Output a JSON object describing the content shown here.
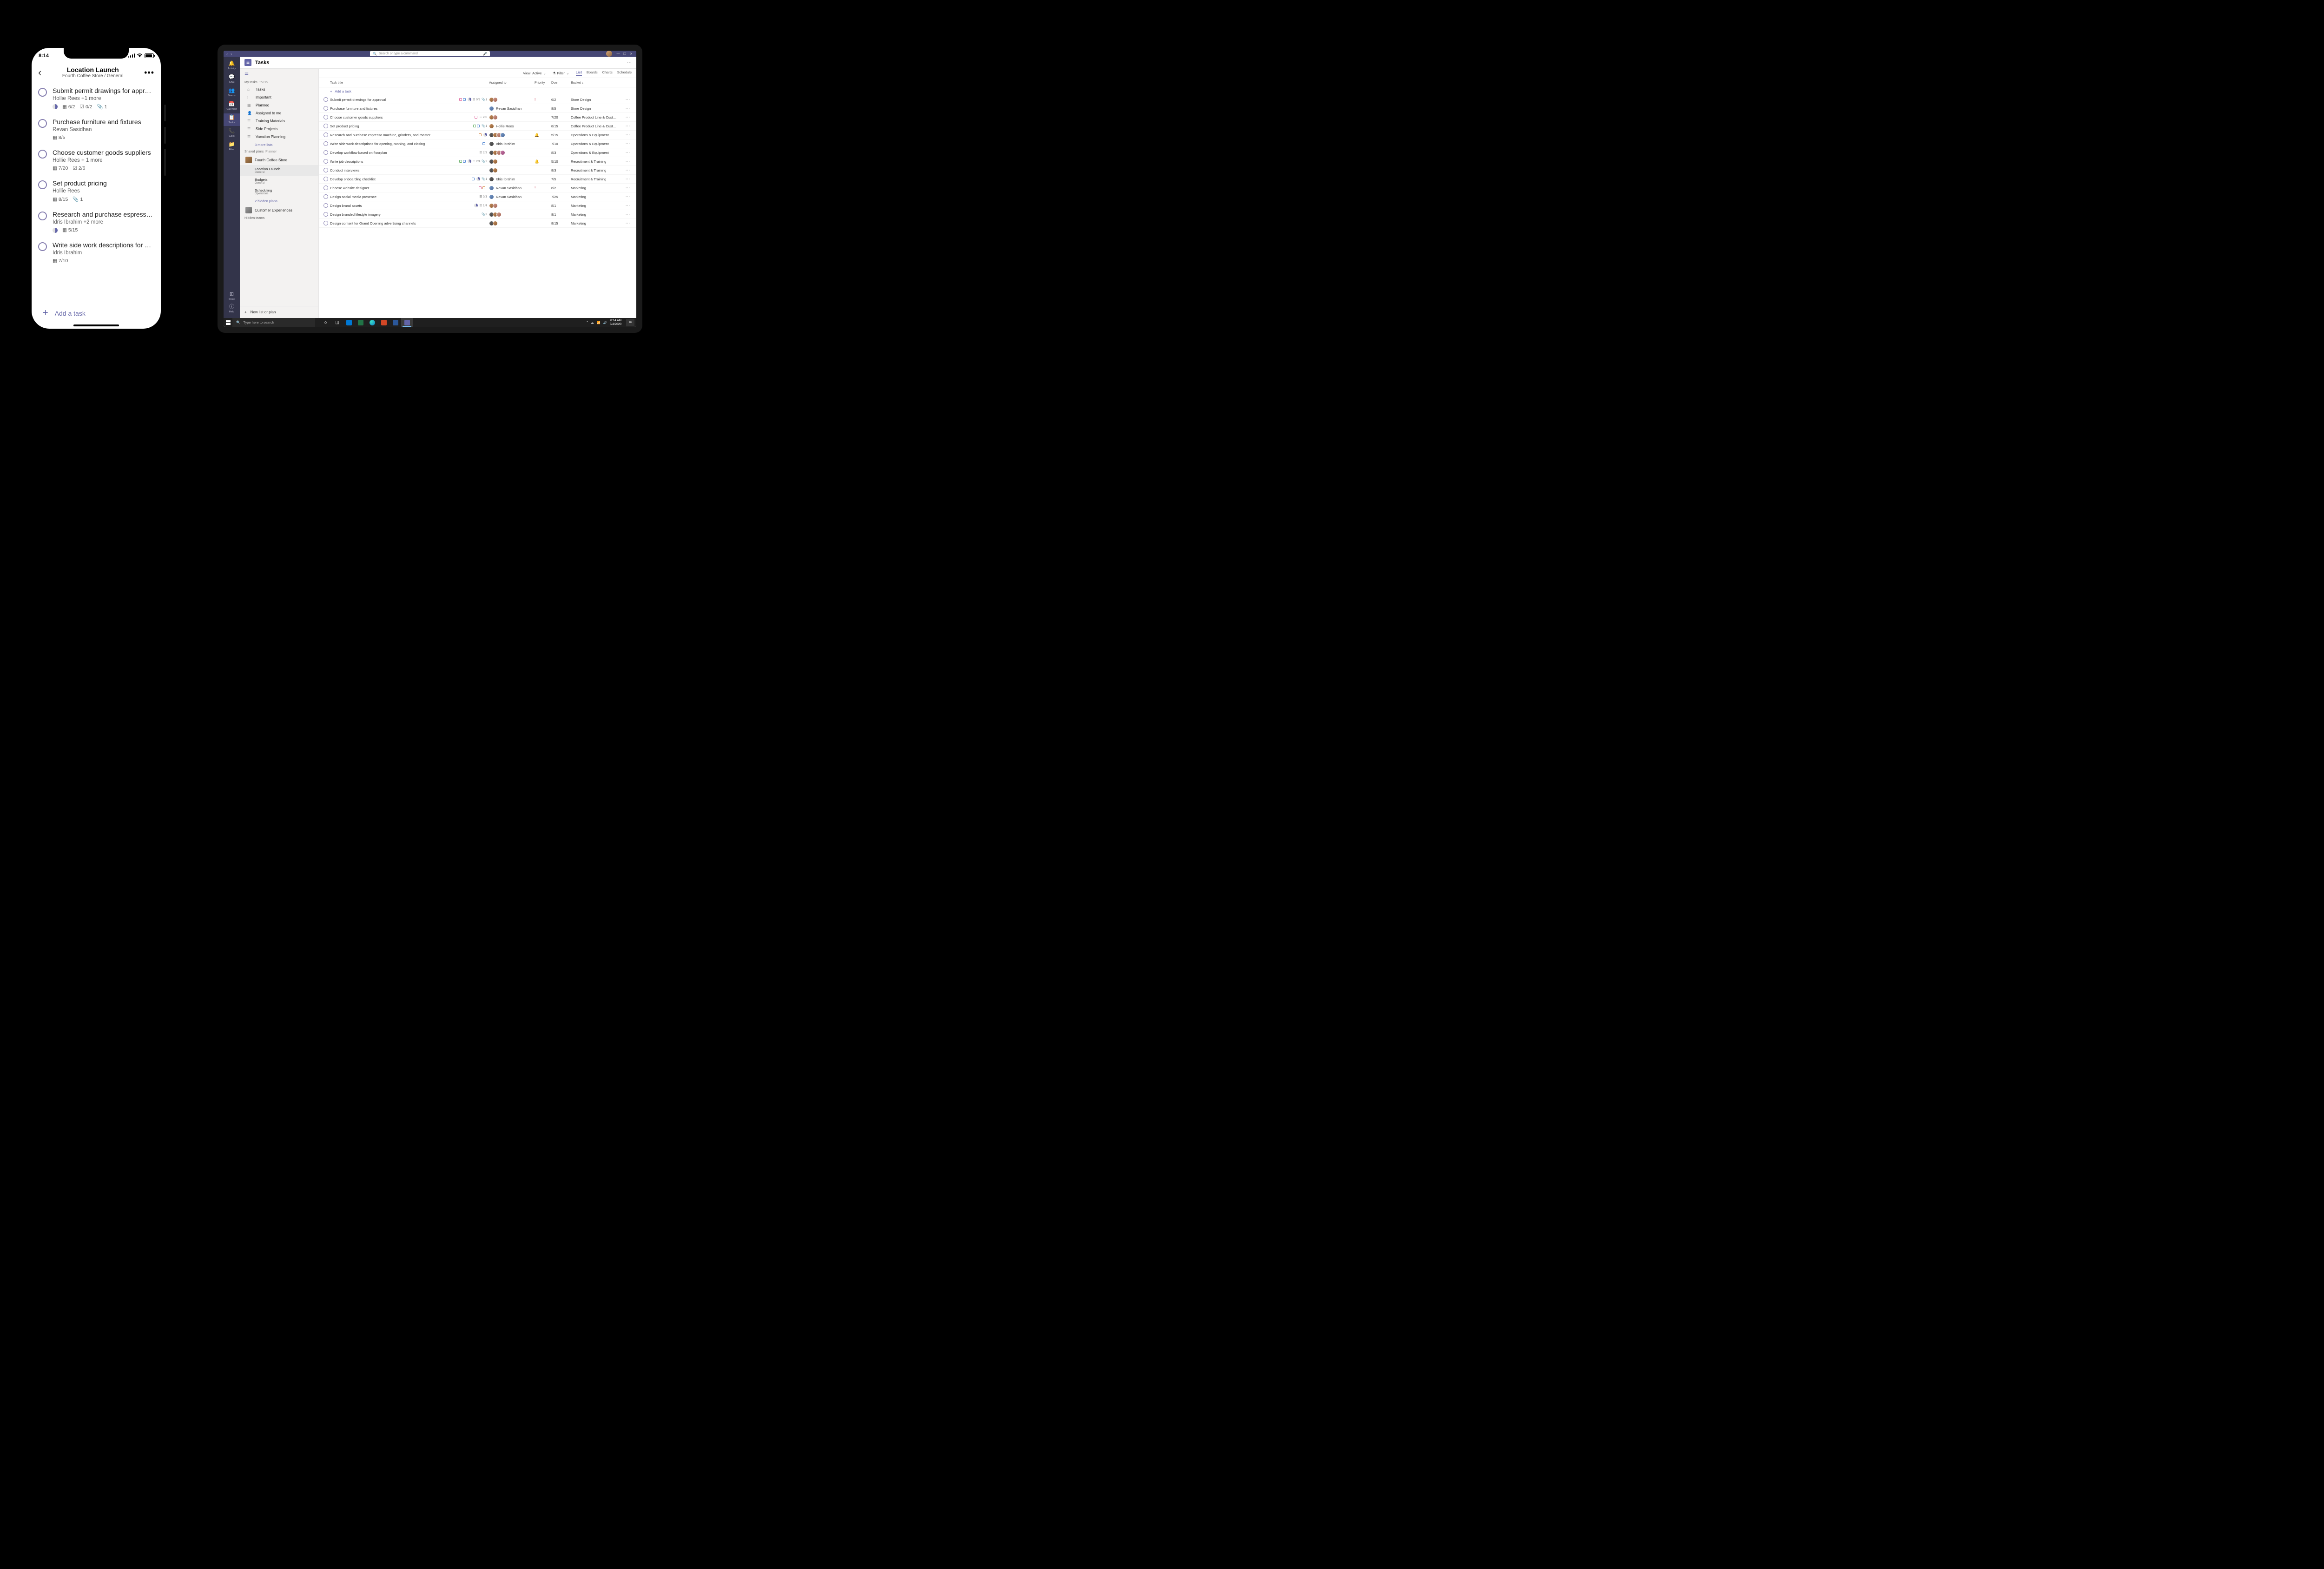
{
  "phone": {
    "time": "8:14",
    "title": "Location Launch",
    "subtitle": "Fourth Coffee Store / General",
    "add": "Add a task",
    "tasks": [
      {
        "title": "Submit permit drawings for approval",
        "assign": "Hollie Rees +1 more",
        "progress": "●",
        "date": "6/2",
        "check": "0/2",
        "attach": "1"
      },
      {
        "title": "Purchase furniture and fixtures",
        "assign": "Revan Sasidhan",
        "date": "8/5"
      },
      {
        "title": "Choose customer goods suppliers",
        "assign": "Hollie Rees + 1 more",
        "date": "7/20",
        "check": "2/6"
      },
      {
        "title": "Set product pricing",
        "assign": "Hollie Rees",
        "date": "8/15",
        "attach": "1"
      },
      {
        "title": "Research and purchase espresso…",
        "assign": "Idris Ibrahim +2 more",
        "progress": "●",
        "date": "5/15"
      },
      {
        "title": "Write side work descriptions for op…",
        "assign": "Idris Ibrahim",
        "date": "7/10"
      }
    ]
  },
  "desktop": {
    "search_ph": "Search or type a command",
    "rail": [
      {
        "ico": "🔔",
        "label": "Activity"
      },
      {
        "ico": "💬",
        "label": "Chat"
      },
      {
        "ico": "👥",
        "label": "Teams"
      },
      {
        "ico": "📅",
        "label": "Calendar"
      },
      {
        "ico": "📋",
        "label": "Tasks"
      },
      {
        "ico": "📞",
        "label": "Calls"
      },
      {
        "ico": "📁",
        "label": "Files"
      }
    ],
    "rail_store": {
      "ico": "⊞",
      "label": "Store"
    },
    "rail_help": {
      "ico": "ⓘ",
      "label": "Help"
    },
    "page_title": "Tasks",
    "view_label": "View: Active",
    "filter_label": "Filter",
    "tabs": [
      "List",
      "Boards",
      "Charts",
      "Schedule"
    ],
    "cols": {
      "title": "Task title",
      "assigned": "Assigned to",
      "priority": "Priority",
      "due": "Due",
      "bucket": "Bucket"
    },
    "bucket_sort": "↓",
    "add_task": "Add a task",
    "sidebar": {
      "sec1": "My tasks",
      "sec1b": "To Do",
      "tasks": "Tasks",
      "important": "Important",
      "planned": "Planned",
      "assigned": "Assigned to me",
      "training": "Training Materials",
      "side": "Side Projects",
      "vacation": "Vacation Planning",
      "more_lists": "3 more lists",
      "sec2": "Shared plans",
      "sec2b": "Planner",
      "team1": "Fourth Coffee Store",
      "plan1": "Location Launch",
      "plan1s": "General",
      "plan2": "Budgets",
      "plan2s": "General",
      "plan3": "Scheduling",
      "plan3s": "Operations",
      "hidden_plans": "2 hidden plans",
      "team2": "Customer Experiences",
      "hidden_teams": "Hidden teams",
      "new": "New list or plan"
    },
    "rows": [
      {
        "t": "Submit permit drawings for approval",
        "chips": [
          "pink",
          "blue"
        ],
        "pie": true,
        "cl": "0/2",
        "att": "1",
        "av": [
          "a",
          "b"
        ],
        "pri": "high",
        "due": "6/2",
        "bkt": "Store Design"
      },
      {
        "t": "Purchase furniture and fixtures",
        "av": [
          "c"
        ],
        "an": "Revan Sasidhan",
        "due": "8/5",
        "bkt": "Store Design"
      },
      {
        "t": "Choose customer goods suppliers",
        "chips": [
          "pink"
        ],
        "cl": "2/6",
        "av": [
          "a",
          "b"
        ],
        "due": "7/20",
        "bkt": "Coffee Product Line & Cust…"
      },
      {
        "t": "Set product pricing",
        "chips": [
          "green",
          "blue"
        ],
        "att": "1",
        "av": [
          "a"
        ],
        "an": "Hollie Rees",
        "due": "8/15",
        "bkt": "Coffee Product Line & Cust…"
      },
      {
        "t": "Research and purchase espresso machine, grinders, and roaster",
        "chips": [
          "orange"
        ],
        "pie": true,
        "av": [
          "d",
          "a",
          "b",
          "c"
        ],
        "pri": "bell",
        "due": "5/15",
        "bkt": "Operations & Equipment"
      },
      {
        "t": "Write side work descriptions for opening, running, and closing",
        "chips": [
          "blue"
        ],
        "av": [
          "d"
        ],
        "an": "Idris Ibrahim",
        "due": "7/10",
        "bkt": "Operations & Equipment"
      },
      {
        "t": "Develop workflow based on floorplan",
        "cl": "2/3",
        "av": [
          "d",
          "a",
          "b",
          "e"
        ],
        "due": "8/3",
        "bkt": "Operations & Equipment"
      },
      {
        "t": "Write job descriptions",
        "chips": [
          "green",
          "blue"
        ],
        "pie": true,
        "cl": "2/4",
        "att": "2",
        "av": [
          "d",
          "a"
        ],
        "pri": "bell",
        "due": "5/10",
        "bkt": "Recruitment & Training"
      },
      {
        "t": "Conduct interviews",
        "av": [
          "d",
          "a"
        ],
        "due": "8/3",
        "bkt": "Recruitment & Training"
      },
      {
        "t": "Develop onboarding checklist",
        "chips": [
          "blue"
        ],
        "pie": true,
        "att": "1",
        "av": [
          "d"
        ],
        "an": "Idris Ibrahim",
        "due": "7/5",
        "bkt": "Recruitment & Training"
      },
      {
        "t": "Choose website designer",
        "chips": [
          "pink",
          "orange"
        ],
        "av": [
          "c"
        ],
        "an": "Revan Sasidhan",
        "pri": "high",
        "due": "6/2",
        "bkt": "Marketing"
      },
      {
        "t": "Design social media presence",
        "cl": "0/3",
        "av": [
          "c"
        ],
        "an": "Revan Sasidhan",
        "due": "7/25",
        "bkt": "Marketing"
      },
      {
        "t": "Design brand assets",
        "pie": true,
        "cl": "1/4",
        "av": [
          "a",
          "b"
        ],
        "due": "8/1",
        "bkt": "Marketing"
      },
      {
        "t": "Design branded lifestyle imagery",
        "att": "3",
        "av": [
          "d",
          "a",
          "b"
        ],
        "due": "8/1",
        "bkt": "Marketing"
      },
      {
        "t": "Design content for Grand Opening advertising channels",
        "av": [
          "d",
          "a"
        ],
        "due": "8/15",
        "bkt": "Marketing"
      }
    ],
    "taskbar": {
      "search": "Type here to search",
      "time": "8:14 AM",
      "date": "5/4/2020",
      "notif": "20"
    }
  }
}
